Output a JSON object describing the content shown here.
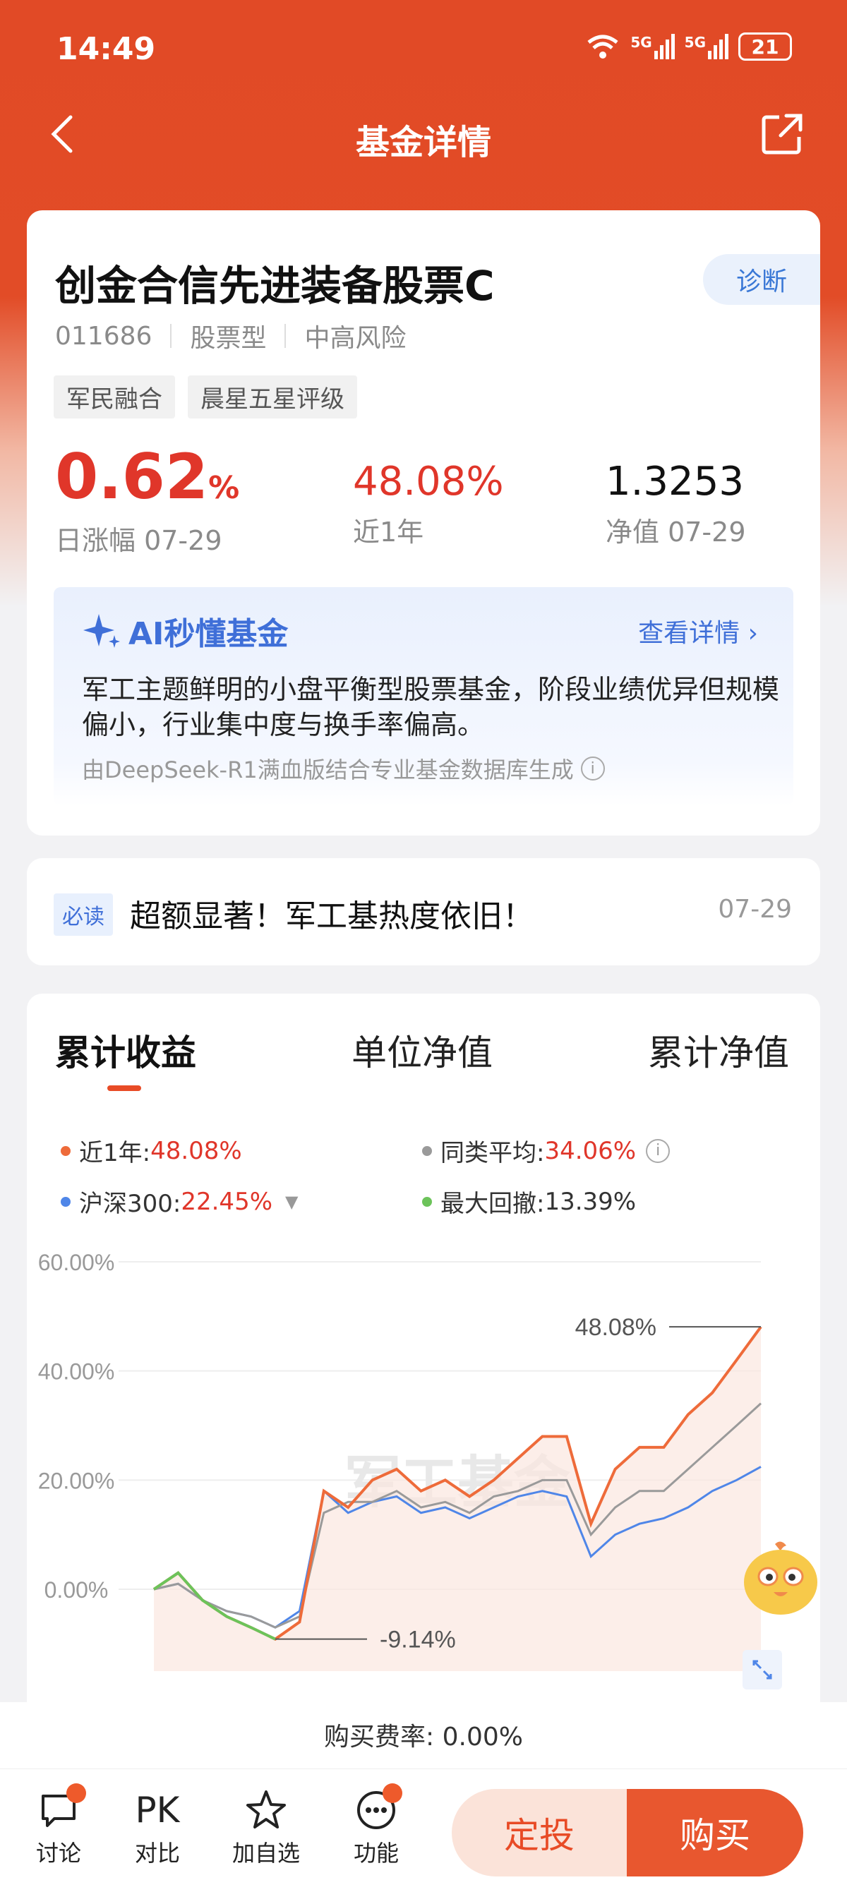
{
  "status_bar": {
    "time": "14:49",
    "battery": "21",
    "net1": "5G",
    "net2": "5G"
  },
  "nav": {
    "title": "基金详情"
  },
  "fund": {
    "name": "创金合信先进装备股票C",
    "code": "011686",
    "type": "股票型",
    "risk": "中高风险",
    "diagnose": "诊断",
    "tags": [
      "军民融合",
      "晨星五星评级"
    ],
    "daily_change": "0.62",
    "daily_change_unit": "%",
    "daily_label": "日涨幅 07-29",
    "year_return": "48.08%",
    "year_label": "近1年",
    "nav_value": "1.3253",
    "nav_label": "净值 07-29"
  },
  "ai": {
    "title": "AI秒懂基金",
    "more": "查看详情",
    "text": "军工主题鲜明的小盘平衡型股票基金，阶段业绩优异但规模偏小，行业集中度与换手率偏高。",
    "source": "由DeepSeek-R1满血版结合专业基金数据库生成"
  },
  "news": {
    "badge": "必读",
    "text": "超额显著！军工基热度依旧！",
    "date": "07-29"
  },
  "chart_tabs": [
    "累计收益",
    "单位净值",
    "累计净值"
  ],
  "legend": {
    "fund_label": "近1年:",
    "fund_value": "48.08%",
    "avg_label": "同类平均:",
    "avg_value": "34.06%",
    "hs300_label": "沪深300:",
    "hs300_value": "22.45%",
    "dd_label": "最大回撤:",
    "dd_value": "13.39%"
  },
  "colors": {
    "accent": "#e84b26",
    "fund": "#ee6b3a",
    "avg": "#9a9a9a",
    "hs300": "#4f86e8",
    "drawdown": "#6cc35a"
  },
  "chart_data": {
    "type": "line",
    "ylim": [
      -15,
      60
    ],
    "yticks": [
      "60.00%",
      "40.00%",
      "20.00%",
      "0.00%"
    ],
    "ytick_values": [
      60,
      40,
      20,
      0
    ],
    "x": [
      0,
      10,
      20,
      30,
      40,
      50,
      60,
      70,
      80,
      90,
      100,
      110,
      120,
      130,
      140,
      150,
      160,
      170,
      180,
      190,
      200,
      210,
      220,
      230,
      240,
      250
    ],
    "series": [
      {
        "name": "近1年",
        "values": [
          0,
          3,
          -2,
          -5,
          -7,
          -9.14,
          -6,
          18,
          15,
          20,
          22,
          18,
          20,
          17,
          20,
          24,
          28,
          28,
          12,
          22,
          26,
          26,
          32,
          36,
          42,
          48.08
        ]
      },
      {
        "name": "同类平均",
        "values": [
          0,
          1,
          -2,
          -4,
          -5,
          -7,
          -5,
          14,
          16,
          16,
          18,
          15,
          16,
          14,
          17,
          18,
          20,
          20,
          10,
          15,
          18,
          18,
          22,
          26,
          30,
          34.06
        ]
      },
      {
        "name": "沪深300",
        "values": [
          0,
          1,
          -2,
          -4,
          -5,
          -7,
          -4,
          18,
          14,
          16,
          17,
          14,
          15,
          13,
          15,
          17,
          18,
          17,
          6,
          10,
          12,
          13,
          15,
          18,
          20,
          22.45
        ]
      }
    ],
    "annotations": {
      "max": "48.08%",
      "min": "-9.14%"
    },
    "watermark": "军工基金"
  },
  "bottom": {
    "fee": "购买费率: 0.00%",
    "nav_items": [
      {
        "label": "讨论",
        "icon": "discuss-icon"
      },
      {
        "label": "对比",
        "icon": "pk-icon",
        "glyph": "PK"
      },
      {
        "label": "加自选",
        "icon": "star-icon"
      },
      {
        "label": "功能",
        "icon": "more-icon"
      }
    ],
    "dingtou": "定投",
    "buy": "购买"
  }
}
